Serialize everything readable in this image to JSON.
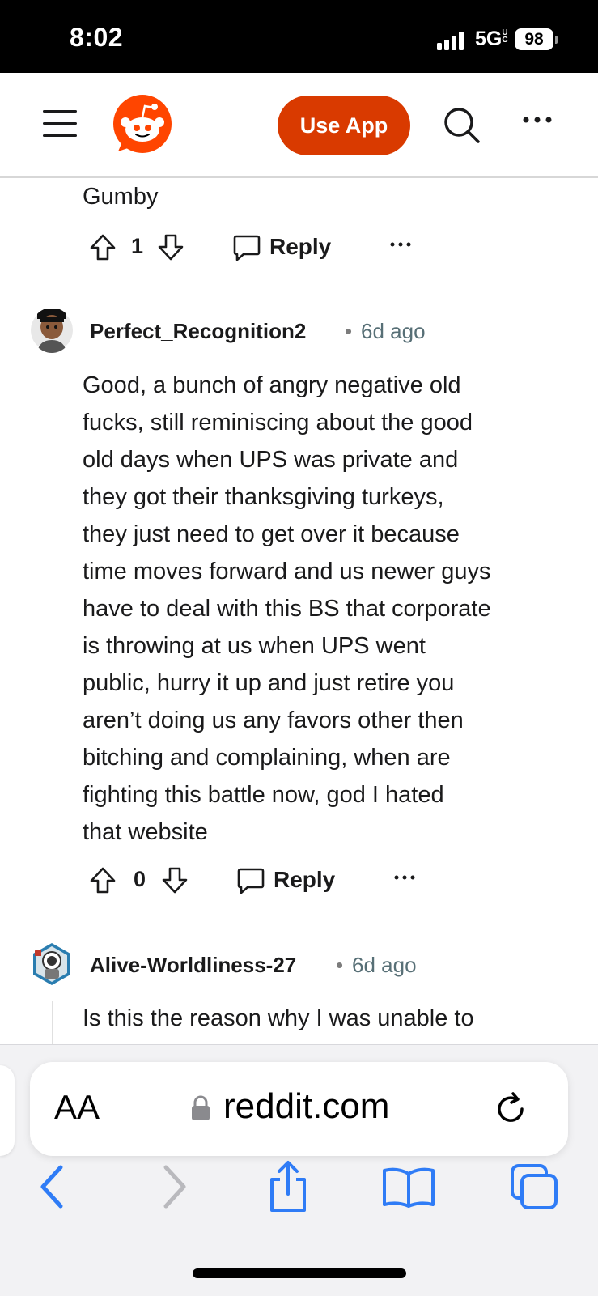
{
  "status_bar": {
    "time": "8:02",
    "network": "5G",
    "network_suffix": "UC",
    "battery": "98"
  },
  "header": {
    "use_app_label": "Use App",
    "brand_color": "#d93a00"
  },
  "comments": [
    {
      "body_tail": "Gumby",
      "score": "1",
      "reply_label": "Reply"
    },
    {
      "username": "Perfect_Recognition2",
      "age": "6d ago",
      "body_lines": [
        "Good, a bunch of angry negative old",
        "fucks, still reminiscing about the good",
        "old days when UPS was private and",
        "they got their thanksgiving turkeys,",
        "they just need to get over it because",
        "time moves forward and us newer guys",
        "have to deal with this BS that corporate",
        "is throwing at us when UPS went",
        "public, hurry it up and just retire you",
        "aren’t doing us any favors other then",
        "bitching and complaining, when are",
        "fighting this battle now, god I hated",
        "that website"
      ],
      "score": "0",
      "reply_label": "Reply"
    },
    {
      "username": "Alive-Worldliness-27",
      "age": "6d ago",
      "body_partial": "Is this the reason why I was unable to"
    }
  ],
  "browser": {
    "aa_label": "AA",
    "url": "reddit.com",
    "accent_color": "#2f7cf6"
  },
  "icons": {
    "header": [
      "menu-icon",
      "reddit-logo-icon",
      "search-icon",
      "more-icon"
    ],
    "actions": [
      "upvote-icon",
      "downvote-icon",
      "comment-icon",
      "more-icon"
    ],
    "browser": [
      "lock-icon",
      "reload-icon",
      "back-icon",
      "forward-icon",
      "share-icon",
      "bookmarks-icon",
      "tabs-icon"
    ]
  }
}
